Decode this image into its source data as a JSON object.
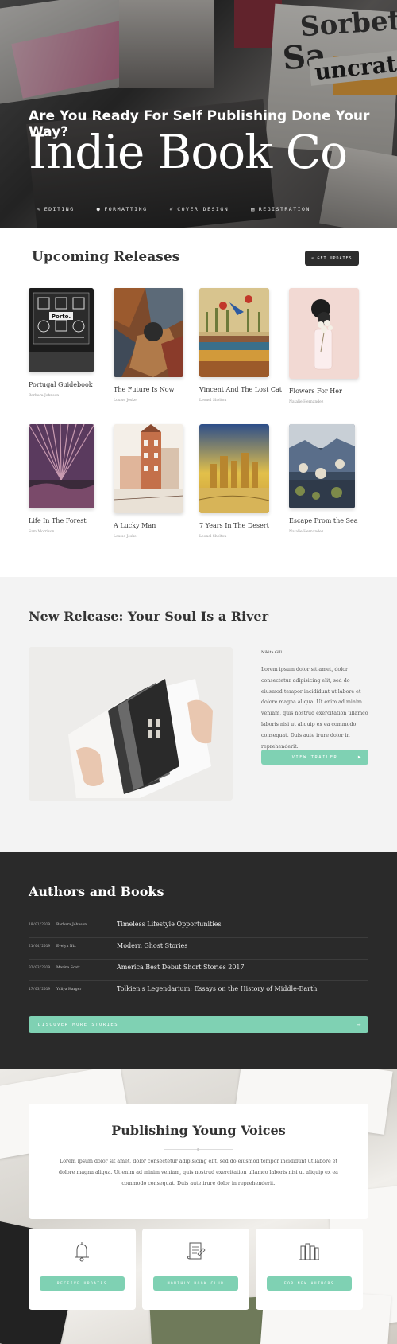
{
  "hero": {
    "tagline": "Are You Ready For Self Publishing Done Your Way?",
    "title": "Indie Book Co",
    "magazine_words": [
      "Sa",
      "Sorbet",
      "uncrate"
    ],
    "services": [
      {
        "label": "EDITING",
        "icon": "pencil-icon"
      },
      {
        "label": "FORMATTING",
        "icon": "chat-icon"
      },
      {
        "label": "COVER DESIGN",
        "icon": "brush-icon"
      },
      {
        "label": "REGISTRATION",
        "icon": "card-icon"
      }
    ]
  },
  "upcoming": {
    "title": "Upcoming Releases",
    "button_label": "GET UPDATES",
    "books": [
      {
        "title": "Portugal Guidebook",
        "author": "Barbara Johnson"
      },
      {
        "title": "The Future Is Now",
        "author": "Louise Jeske"
      },
      {
        "title": "Vincent And The Lost Cat",
        "author": "Leonel Shelton"
      },
      {
        "title": "Flowers For Her",
        "author": "Natalie Hernandez"
      },
      {
        "title": "Life In The Forest",
        "author": "Sam Morrison"
      },
      {
        "title": "A Lucky Man",
        "author": "Louise Jeske"
      },
      {
        "title": "7 Years In The Desert",
        "author": "Leonel Shelton"
      },
      {
        "title": "Escape From the Sea",
        "author": "Natalie Hernandez"
      }
    ]
  },
  "new_release": {
    "title": "New Release: Your Soul Is a River",
    "author": "Nikita Gill",
    "text": "Lorem ipsum dolor sit amet, dolor consectetur adipisicing elit, sed do eiusmod tempor incididunt ut labore et dolore magna aliqua. Ut enim ad minim veniam, quis nostrud exercitation ullamco laboris nisi ut aliquip ex ea commodo consequat. Duis aute irure dolor in reprehenderit.",
    "button_label": "VIEW TRAILER"
  },
  "authors": {
    "title": "Authors and Books",
    "rows": [
      {
        "date": "18/01/2019",
        "name": "Barbara Johnson",
        "book": "Timeless Lifestyle Opportunities"
      },
      {
        "date": "21/04/2019",
        "name": "Evelyn Nix",
        "book": "Modern Ghost Stories"
      },
      {
        "date": "02/03/2019",
        "name": "Marina Scott",
        "book": "America Best Debut Short Stories 2017"
      },
      {
        "date": "17/03/2019",
        "name": "Yuliya Harger",
        "book": "Tolkien's Legendarium: Essays on the History of Middle-Earth"
      }
    ],
    "button_label": "DISCOVER MORE STORIES"
  },
  "voices": {
    "title": "Publishing Young Voices",
    "text": "Lorem ipsum dolor sit amet, dolor consectetur adipisicing elit, sed do eiusmod tempor incididunt ut labore et dolore magna aliqua. Ut enim ad minim veniam, quis nostrud exercitation ullamco laboris nisi ut aliquip ex ea commodo consequat. Duis aute irure dolor in reprehenderit.",
    "cards": [
      {
        "button_label": "RECEIVE UPDATES",
        "icon": "bell-icon"
      },
      {
        "button_label": "MONTHLY BOOK CLUB",
        "icon": "scroll-icon"
      },
      {
        "button_label": "FOR NEW AUTHORS",
        "icon": "books-icon"
      }
    ]
  },
  "colors": {
    "accent": "#7fd1b3",
    "dark": "#2a2a2a",
    "light_bg": "#f3f3f3"
  }
}
